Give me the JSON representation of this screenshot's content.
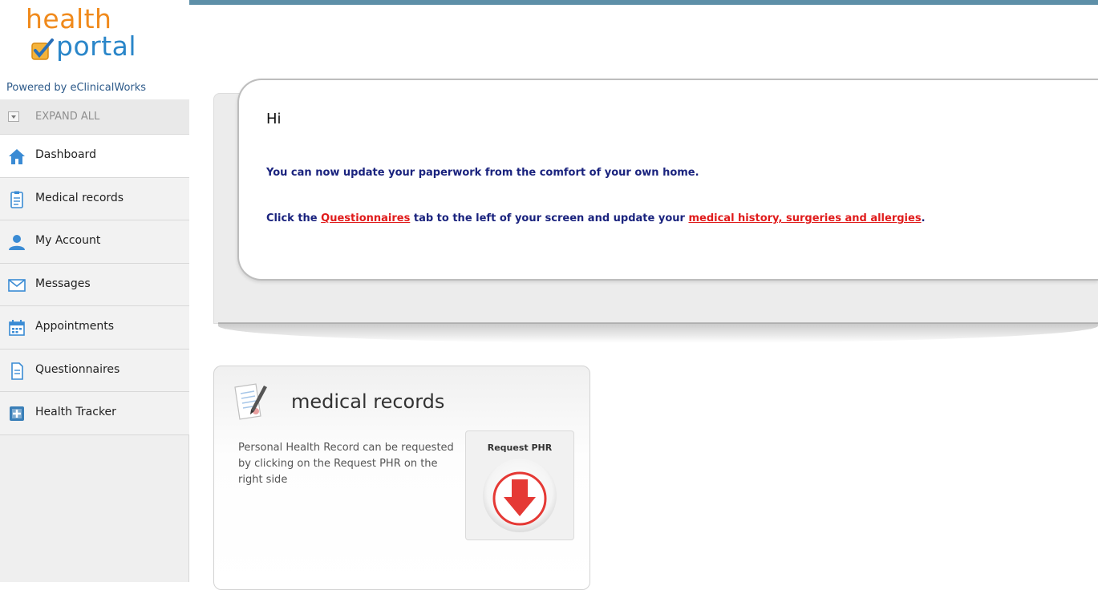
{
  "brand": {
    "logo_top": "health",
    "logo_bottom": "portal",
    "powered_by": "Powered by eClinicalWorks"
  },
  "sidebar": {
    "expand_all": "EXPAND ALL",
    "items": [
      {
        "label": "Dashboard",
        "icon": "house-icon",
        "active": true
      },
      {
        "label": "Medical records",
        "icon": "clipboard-icon"
      },
      {
        "label": "My Account",
        "icon": "user-icon"
      },
      {
        "label": "Messages",
        "icon": "envelope-icon"
      },
      {
        "label": "Appointments",
        "icon": "calendar-icon"
      },
      {
        "label": "Questionnaires",
        "icon": "document-icon"
      },
      {
        "label": "Health Tracker",
        "icon": "tracker-icon"
      }
    ]
  },
  "greeting": {
    "hi": "Hi",
    "line1": "You can now update your paperwork from the comfort of your own home.",
    "line2_pre": "Click the ",
    "line2_link1": "Questionnaires",
    "line2_mid": " tab to the left of your screen and update your ",
    "line2_link2": "medical history, surgeries and allergies",
    "line2_post": "."
  },
  "medical_records_widget": {
    "title": "medical records",
    "description": "Personal Health Record can be requested by clicking on the Request PHR on the right side",
    "request_label": "Request PHR"
  },
  "colors": {
    "accent_bar": "#5d8fa8",
    "message_text": "#1a237e",
    "link": "#e01b1b",
    "download_arrow": "#e53935"
  }
}
